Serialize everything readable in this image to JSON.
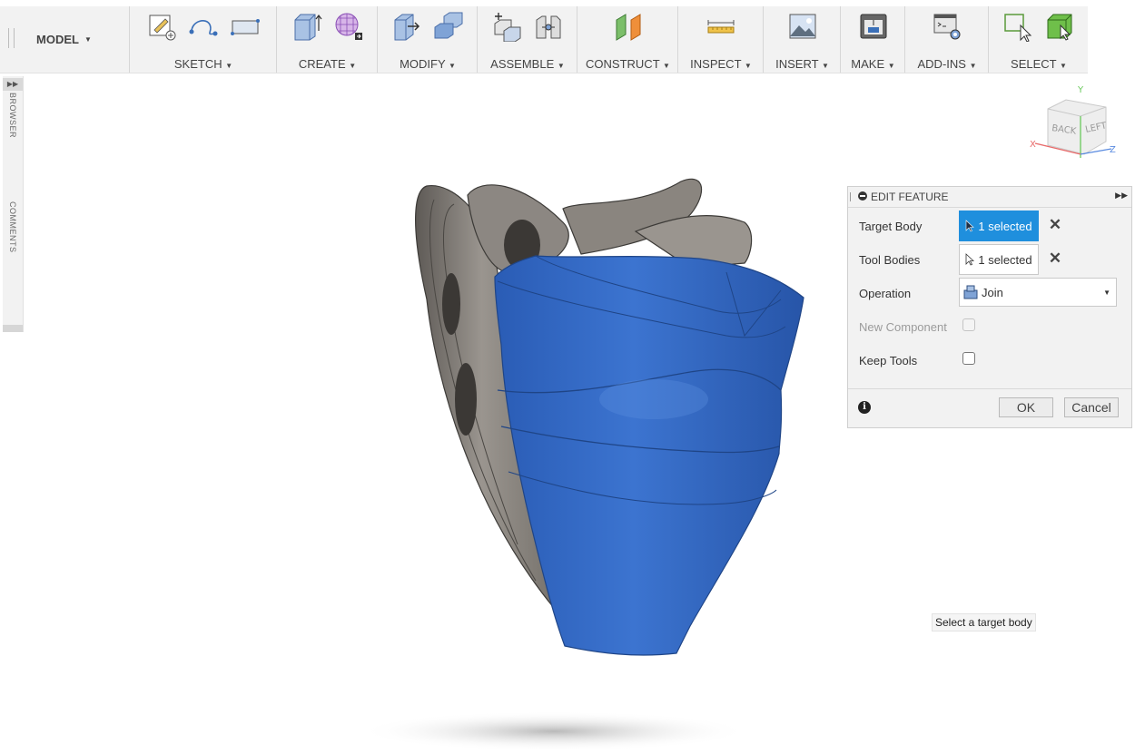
{
  "toolbar": {
    "workspace_label": "MODEL",
    "groups": [
      {
        "label": "SKETCH",
        "icons": [
          "sketch-create-icon",
          "spline-icon",
          "rectangle-icon"
        ]
      },
      {
        "label": "CREATE",
        "icons": [
          "extrude-icon",
          "form-icon"
        ]
      },
      {
        "label": "MODIFY",
        "icons": [
          "press-pull-icon",
          "combine-icon"
        ]
      },
      {
        "label": "ASSEMBLE",
        "icons": [
          "new-component-icon",
          "joint-icon"
        ]
      },
      {
        "label": "CONSTRUCT",
        "icons": [
          "offset-plane-icon"
        ]
      },
      {
        "label": "INSPECT",
        "icons": [
          "measure-icon"
        ]
      },
      {
        "label": "INSERT",
        "icons": [
          "insert-image-icon"
        ]
      },
      {
        "label": "MAKE",
        "icons": [
          "3d-print-icon"
        ]
      },
      {
        "label": "ADD-INS",
        "icons": [
          "scripts-addins-icon"
        ]
      },
      {
        "label": "SELECT",
        "icons": [
          "select-cursor-icon",
          "select-box-icon"
        ]
      }
    ]
  },
  "side_tabs": {
    "browser": "BROWSER",
    "comments": "COMMENTS"
  },
  "viewcube": {
    "back": "BACK",
    "left": "LEFT",
    "axis_x": "X",
    "axis_y": "Y",
    "axis_z": "Z"
  },
  "edit_feature": {
    "title": "EDIT FEATURE",
    "target_body_label": "Target Body",
    "target_body_value": "1 selected",
    "tool_bodies_label": "Tool Bodies",
    "tool_bodies_value": "1 selected",
    "operation_label": "Operation",
    "operation_value": "Join",
    "new_component_label": "New Component",
    "keep_tools_label": "Keep Tools",
    "ok_label": "OK",
    "cancel_label": "Cancel",
    "info_symbol": "i"
  },
  "tooltip": {
    "text": "Select a target body"
  },
  "colors": {
    "selection_blue": "#1f8fdd",
    "body_blue": "#2f66c2",
    "body_gray": "#8a8580"
  }
}
